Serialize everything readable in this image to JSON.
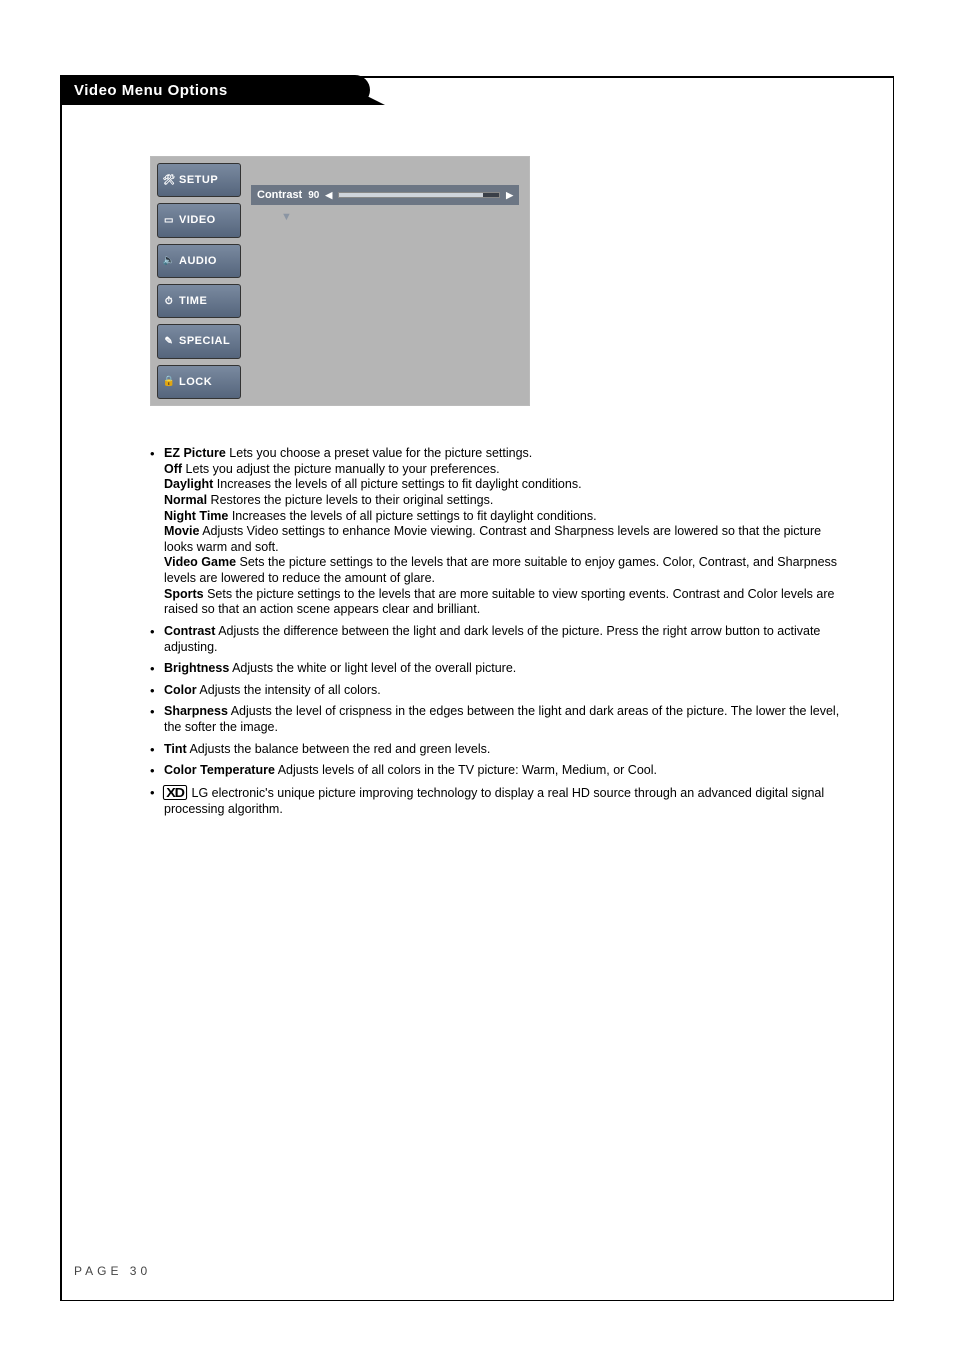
{
  "heading": "Video Menu Options",
  "osd": {
    "tabs": [
      {
        "label": "SETUP",
        "icon": "🛠"
      },
      {
        "label": "VIDEO",
        "icon": "▭"
      },
      {
        "label": "AUDIO",
        "icon": "🔈"
      },
      {
        "label": "TIME",
        "icon": "⏱"
      },
      {
        "label": "SPECIAL",
        "icon": "✎"
      },
      {
        "label": "LOCK",
        "icon": "🔒"
      }
    ],
    "slider": {
      "label": "Contrast",
      "value": "90",
      "percent": 90
    }
  },
  "items": [
    {
      "term": "EZ Picture",
      "rest": "  Lets you choose a preset value for the picture settings.",
      "subs": [
        {
          "t": "Off",
          "d": " Lets you adjust the picture manually to your preferences."
        },
        {
          "t": "Daylight",
          "d": "  Increases the levels of all picture settings to fit daylight conditions."
        },
        {
          "t": "Normal",
          "d": " Restores the picture levels to their original settings."
        },
        {
          "t": "Night Time",
          "d": " Increases the levels of all picture settings to fit daylight conditions."
        },
        {
          "t": "Movie",
          "d": " Adjusts Video settings to enhance Movie viewing. Contrast and Sharpness levels are lowered so that the picture looks warm and soft."
        },
        {
          "t": "Video Game",
          "d": " Sets the picture settings to the levels that are more suitable to enjoy games. Color, Contrast, and Sharpness levels are lowered to reduce the amount of glare."
        },
        {
          "t": "Sports",
          "d": " Sets the picture settings to the levels that are more suitable to view sporting events. Contrast and Color levels are raised so that an action scene appears clear and brilliant."
        }
      ]
    },
    {
      "term": "Contrast",
      "rest": "  Adjusts the difference between the light and dark levels of the picture. Press the right arrow button to activate adjusting."
    },
    {
      "term": "Brightness",
      "rest": "  Adjusts the white or light level of the overall picture."
    },
    {
      "term": "Color",
      "rest": "  Adjusts the intensity of all colors."
    },
    {
      "term": "Sharpness",
      "rest": "  Adjusts the level of crispness in the edges between the light and dark areas of the picture. The lower the level, the softer the image."
    },
    {
      "term": "Tint",
      "rest": "  Adjusts the balance between the red and green levels."
    },
    {
      "term": "Color Temperature",
      "rest": "  Adjusts levels of all colors in the TV picture: Warm, Medium, or Cool."
    },
    {
      "xd": true,
      "rest": " LG electronic's unique picture improving technology to display a real HD source through an advanced digital signal processing algorithm."
    }
  ],
  "page_label": "PAGE 30",
  "xd_mark": "XD"
}
